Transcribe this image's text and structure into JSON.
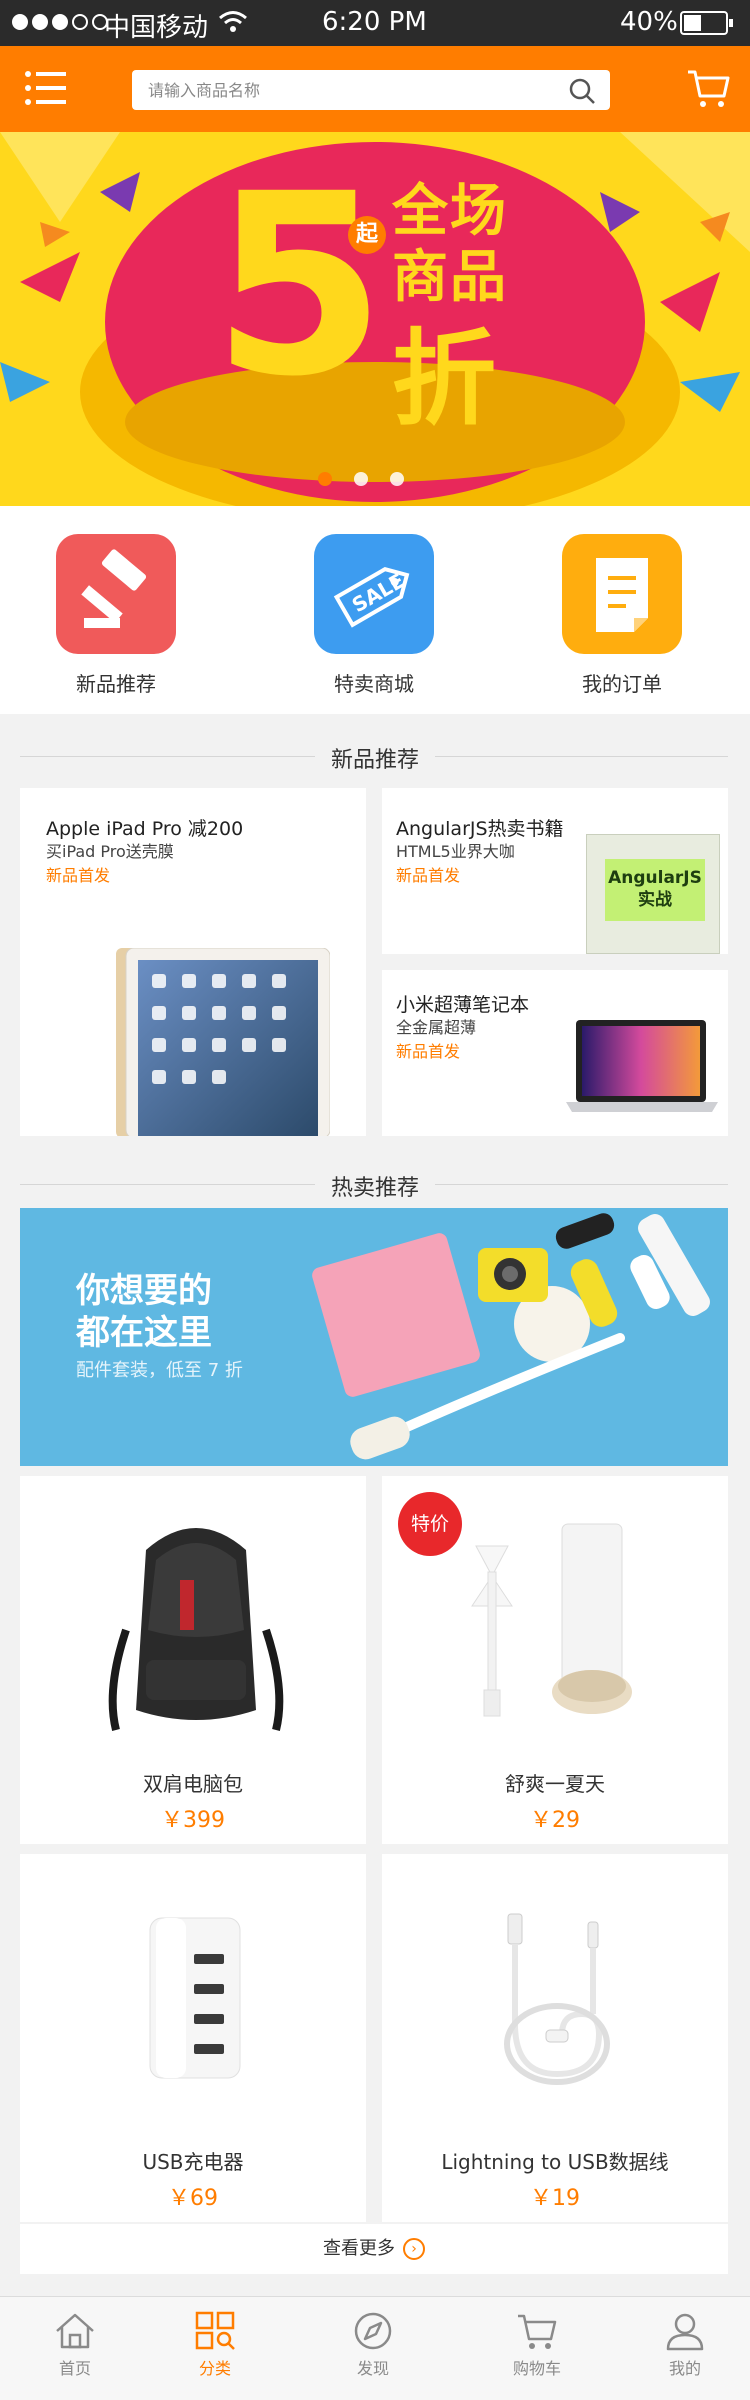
{
  "status_bar": {
    "carrier": "中国移动",
    "time": "6:20 PM",
    "battery": "40%"
  },
  "header": {
    "search_placeholder": "请输入商品名称"
  },
  "banner": {
    "big_number": "5",
    "qi": "起",
    "line1": "全场",
    "line2": "商品",
    "line3": "折",
    "slides": 3,
    "active_slide": 1
  },
  "quick_nav": [
    {
      "label": "新品推荐",
      "color": "#f05a5a"
    },
    {
      "label": "特卖商城",
      "color": "#3d9cf0"
    },
    {
      "label": "我的订单",
      "color": "#ffad0e"
    }
  ],
  "new_section": {
    "title": "新品推荐",
    "cards": [
      {
        "title": "Apple  iPad Pro 减200",
        "sub": "买iPad Pro送壳膜",
        "tag": "新品首发"
      },
      {
        "title": "AngularJS热卖书籍",
        "sub": "HTML5业界大咖",
        "tag": "新品首发",
        "book_title": "AngularJS\n实战"
      },
      {
        "title": "小米超薄笔记本",
        "sub": "全金属超薄",
        "tag": "新品首发"
      }
    ]
  },
  "hot_section": {
    "title": "热卖推荐",
    "banner_line1": "你想要的",
    "banner_line2": "都在这里",
    "banner_sub": "配件套装，低至 7 折"
  },
  "products": [
    {
      "name": "双肩电脑包",
      "price": "￥399",
      "badge": ""
    },
    {
      "name": "舒爽一夏天",
      "price": "￥29",
      "badge": "特价"
    },
    {
      "name": "USB充电器",
      "price": "￥69",
      "badge": ""
    },
    {
      "name": "Lightning to USB数据线",
      "price": "￥19",
      "badge": ""
    }
  ],
  "more_label": "查看更多",
  "tabs": [
    {
      "label": "首页",
      "icon": "home-icon"
    },
    {
      "label": "分类",
      "icon": "category-icon"
    },
    {
      "label": "发现",
      "icon": "compass-icon"
    },
    {
      "label": "购物车",
      "icon": "cart-icon"
    },
    {
      "label": "我的",
      "icon": "user-icon"
    }
  ],
  "colors": {
    "brand": "#ff7d00",
    "status_bar": "#2b2b2b",
    "badge": "#e8282b"
  }
}
